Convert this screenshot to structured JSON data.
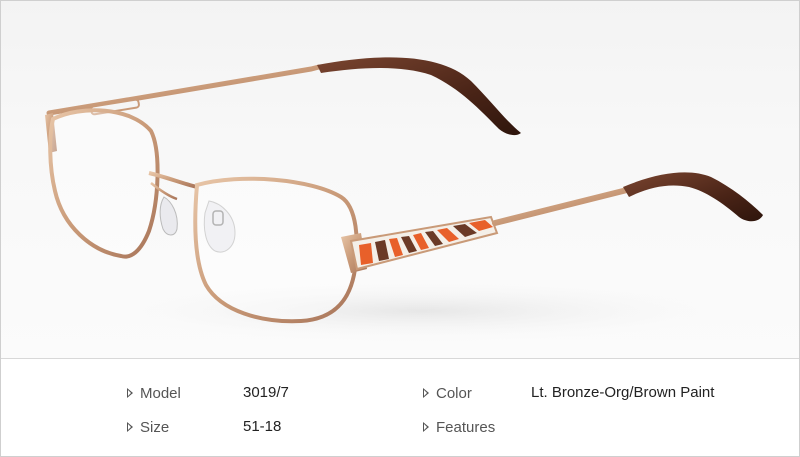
{
  "product": {
    "image_alt": "eyeglasses-product-photo",
    "colors": {
      "frame": "#c99a78",
      "frame_dark": "#a8755a",
      "temple_tip": "#5a2e1c",
      "paint_orange": "#e8602a",
      "paint_brown": "#6b3a26"
    }
  },
  "specs": {
    "model_label": "Model",
    "model_value": "3019/7",
    "size_label": "Size",
    "size_value": "51-18",
    "color_label": "Color",
    "color_value": "Lt. Bronze-Org/Brown Paint",
    "features_label": "Features"
  }
}
